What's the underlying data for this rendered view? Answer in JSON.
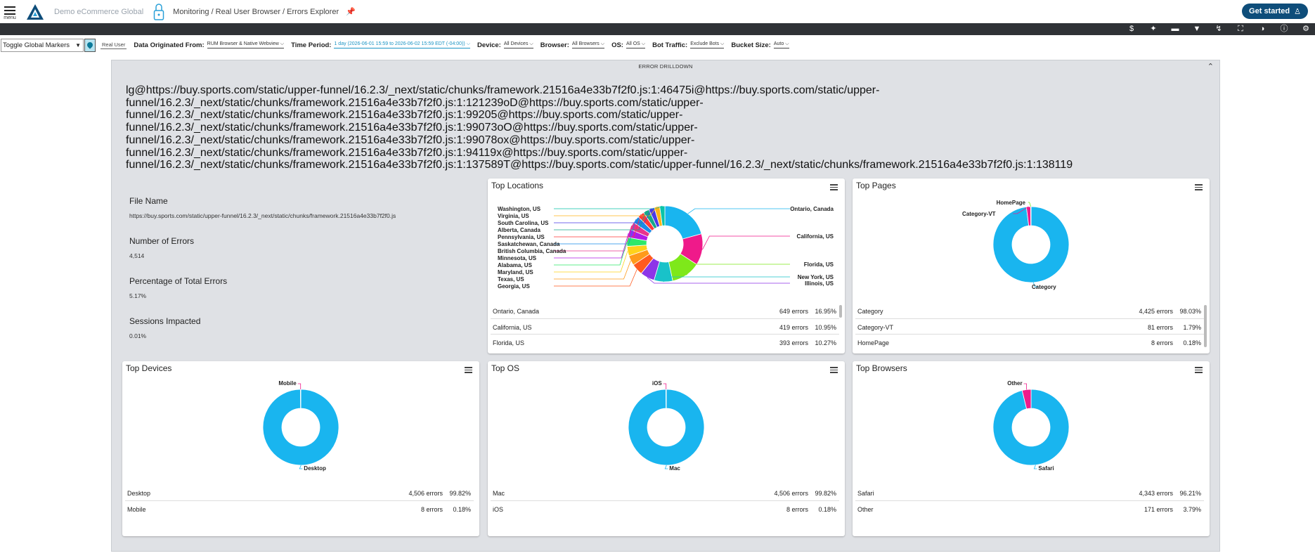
{
  "header": {
    "menu_label": "menu",
    "app_name": "Demo eCommerce Global",
    "breadcrumb": "Monitoring / Real User Browser / Errors Explorer",
    "get_started": "Get started"
  },
  "toolbar_icons": [
    "dollar-icon",
    "sparkle-icon",
    "comment-icon",
    "filter-icon",
    "bolt-icon",
    "fullscreen-icon",
    "contrast-icon",
    "help-icon",
    "settings-icon"
  ],
  "filters": {
    "toggle_markers": "Toggle Global Markers",
    "real_user_chip": "Real User",
    "data_origin_label": "Data Originated From:",
    "data_origin_value": "RUM Browser & Native Webview",
    "time_period_label": "Time Period:",
    "time_period_value": "1 day (2026-06-01 15:59 to 2026-06-02 15:59 EDT (-04:00))",
    "device_label": "Device:",
    "device_value": "All Devices",
    "browser_label": "Browser:",
    "browser_value": "All Browsers",
    "os_label": "OS:",
    "os_value": "All OS",
    "bot_label": "Bot Traffic:",
    "bot_value": "Exclude Bots",
    "bucket_label": "Bucket Size:",
    "bucket_value": "Auto"
  },
  "drilldown": {
    "title": "ERROR DRILLDOWN",
    "stack_lines": [
      "lg@https://buy.sports.com/static/upper-funnel/16.2.3/_next/static/chunks/framework.21516a4e33b7f2f0.js:1:46475i@https://buy.sports.com/static/upper-",
      "funnel/16.2.3/_next/static/chunks/framework.21516a4e33b7f2f0.js:1:121239oD@https://buy.sports.com/static/upper-",
      "funnel/16.2.3/_next/static/chunks/framework.21516a4e33b7f2f0.js:1:99205@https://buy.sports.com/static/upper-",
      "funnel/16.2.3/_next/static/chunks/framework.21516a4e33b7f2f0.js:1:99073oO@https://buy.sports.com/static/upper-",
      "funnel/16.2.3/_next/static/chunks/framework.21516a4e33b7f2f0.js:1:99078ox@https://buy.sports.com/static/upper-",
      "funnel/16.2.3/_next/static/chunks/framework.21516a4e33b7f2f0.js:1:94119x@https://buy.sports.com/static/upper-",
      "funnel/16.2.3/_next/static/chunks/framework.21516a4e33b7f2f0.js:1:137589T@https://buy.sports.com/static/upper-funnel/16.2.3/_next/static/chunks/framework.21516a4e33b7f2f0.js:1:138119"
    ],
    "file_name_label": "File Name",
    "file_name_value": "https://buy.sports.com/static/upper-funnel/16.2.3/_next/static/chunks/framework.21516a4e33b7f2f0.js",
    "errors_label": "Number of Errors",
    "errors_value": "4,514",
    "pct_label": "Percentage of Total Errors",
    "pct_value": "5.17%",
    "sessions_label": "Sessions Impacted",
    "sessions_value": "0.01%"
  },
  "cards": {
    "locations": {
      "title": "Top Locations",
      "left_labels": [
        "Washington, US",
        "Virginia, US",
        "South Carolina, US",
        "Alberta, Canada",
        "Pennsylvania, US",
        "Saskatchewan, Canada",
        "British Columbia, Canada",
        "Minnesota, US",
        "Alabama, US",
        "Maryland, US",
        "Texas, US",
        "Georgia, US"
      ],
      "right_labels": [
        "Ontario, Canada",
        "California, US",
        "Florida, US",
        "New York, US",
        "Illinois, US"
      ],
      "rows": [
        {
          "name": "Ontario, Canada",
          "errors": "649 errors",
          "pct": "16.95%"
        },
        {
          "name": "California, US",
          "errors": "419 errors",
          "pct": "10.95%"
        },
        {
          "name": "Florida, US",
          "errors": "393 errors",
          "pct": "10.27%"
        }
      ]
    },
    "pages": {
      "title": "Top Pages",
      "labels": [
        "HomePage",
        "Category-VT",
        "Category"
      ],
      "rows": [
        {
          "name": "Category",
          "errors": "4,425 errors",
          "pct": "98.03%"
        },
        {
          "name": "Category-VT",
          "errors": "81 errors",
          "pct": "1.79%"
        },
        {
          "name": "HomePage",
          "errors": "8 errors",
          "pct": "0.18%"
        }
      ]
    },
    "devices": {
      "title": "Top Devices",
      "labels": [
        "Mobile",
        "Desktop"
      ],
      "rows": [
        {
          "name": "Desktop",
          "errors": "4,506 errors",
          "pct": "99.82%"
        },
        {
          "name": "Mobile",
          "errors": "8 errors",
          "pct": "0.18%"
        }
      ]
    },
    "os": {
      "title": "Top OS",
      "labels": [
        "iOS",
        "Mac"
      ],
      "rows": [
        {
          "name": "Mac",
          "errors": "4,506 errors",
          "pct": "99.82%"
        },
        {
          "name": "iOS",
          "errors": "8 errors",
          "pct": "0.18%"
        }
      ]
    },
    "browsers": {
      "title": "Top Browsers",
      "labels": [
        "Other",
        "Safari"
      ],
      "rows": [
        {
          "name": "Safari",
          "errors": "4,343 errors",
          "pct": "96.21%"
        },
        {
          "name": "Other",
          "errors": "171 errors",
          "pct": "3.79%"
        }
      ]
    }
  },
  "chart_data": [
    {
      "type": "pie",
      "title": "Top Locations",
      "categories": [
        "Ontario, Canada",
        "California, US",
        "Florida, US",
        "New York, US",
        "Illinois, US",
        "Georgia, US",
        "Texas, US",
        "Maryland, US",
        "Alabama, US",
        "Minnesota, US",
        "British Columbia, Canada",
        "Saskatchewan, Canada",
        "Pennsylvania, US",
        "Alberta, Canada",
        "South Carolina, US",
        "Virginia, US",
        "Washington, US"
      ],
      "values": [
        16.95,
        10.95,
        10.27,
        6.5,
        5.0,
        4.0,
        3.5,
        3.3,
        3.1,
        2.9,
        2.7,
        2.5,
        2.3,
        2.1,
        2.0,
        1.9,
        1.8
      ],
      "colors": [
        "#19b5ef",
        "#ef1a8a",
        "#7ee81a",
        "#19c2c9",
        "#8d35e8",
        "#ff5a1f",
        "#ff9a1a",
        "#ffd21a",
        "#2ee86a",
        "#b01ae8",
        "#e8338c",
        "#1a8ae8",
        "#ff3a3a",
        "#18a88a",
        "#4a3ae8",
        "#ffb31a",
        "#0ac4a8"
      ]
    },
    {
      "type": "pie",
      "title": "Top Pages",
      "categories": [
        "Category",
        "Category-VT",
        "HomePage"
      ],
      "values": [
        4425,
        81,
        8
      ],
      "colors": [
        "#19b5ef",
        "#ef1a8a",
        "#7ee81a"
      ]
    },
    {
      "type": "pie",
      "title": "Top Devices",
      "categories": [
        "Desktop",
        "Mobile"
      ],
      "values": [
        4506,
        8
      ],
      "colors": [
        "#19b5ef",
        "#ef1a8a"
      ]
    },
    {
      "type": "pie",
      "title": "Top OS",
      "categories": [
        "Mac",
        "iOS"
      ],
      "values": [
        4506,
        8
      ],
      "colors": [
        "#19b5ef",
        "#ef1a8a"
      ]
    },
    {
      "type": "pie",
      "title": "Top Browsers",
      "categories": [
        "Safari",
        "Other"
      ],
      "values": [
        4343,
        171
      ],
      "colors": [
        "#19b5ef",
        "#ef1a8a"
      ]
    }
  ]
}
